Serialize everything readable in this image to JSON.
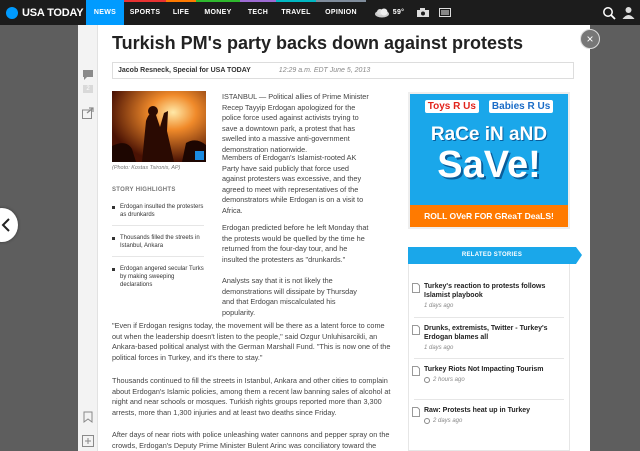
{
  "nav": {
    "logo": "USA TODAY",
    "items": [
      "NEWS",
      "SPORTS",
      "LIFE",
      "MONEY",
      "TECH",
      "TRAVEL",
      "OPINION"
    ],
    "temperature": "59°",
    "colors": {
      "news": "#009bff",
      "sports": "#e83131",
      "life": "#ff7a00",
      "money": "#2fb82e",
      "tech": "#9d6bd2",
      "travel": "#00b7c2",
      "opinion": "#7f8c9b"
    }
  },
  "article": {
    "title": "Turkish PM's party backs down against protests",
    "author": "Jacob Resneck, Special for USA TODAY",
    "date": "12:29 a.m. EDT June 5, 2013",
    "photo_caption": "(Photo: Kostas Tsironis, AP)",
    "highlights_title": "STORY HIGHLIGHTS",
    "highlights": [
      "Erdogan insulted the protesters as drunkards",
      "Thousands filled the streets in Istanbul, Ankara",
      "Erdogan angered secular Turks by making sweeping declarations"
    ],
    "paragraphs": [
      "ISTANBUL — Political allies of Prime Minister Recep Tayyip Erdogan apologized for the police force used against activists trying to save a downtown park, a protest that has swelled into a massive anti-government demonstration nationwide.",
      "Members of Erdogan's Islamist-rooted AK Party have said publicly that force used against protesters was excessive, and they agreed to meet with representatives of the demonstrators while Erdogan is on a visit to Africa.",
      "Erdogan predicted before he left Monday that the protests would be quelled by the time he returned from the four-day tour, and he insulted the protesters as \"drunkards.\"",
      "Analysts say that it is not likely the demonstrations will dissipate by Thursday and that Erdogan miscalculated his popularity.",
      "\"Even if Erdogan resigns today, the movement will be there as a latent force to come out when the leadership doesn't listen to the people,\" said Ozgur Unluhisarcikli, an Ankara-based political analyst with the German Marshall Fund. \"This is now one of the political forces in Turkey, and it's there to stay.\"",
      "Thousands continued to fill the streets in Istanbul, Ankara and other cities to complain about Erdogan's Islamic policies, among them a recent law banning sales of alcohol at night and near schools or mosques. Turkish rights groups reported more than 3,300 arrests, more than 1,300 injuries and at least two deaths since Friday.",
      "After days of near riots with police unleashing water cannons and pepper spray on the crowds, Erdogan's Deputy Prime Minister Bulent Arinc was conciliatory toward the"
    ],
    "comment_count": "2"
  },
  "ad": {
    "brand1": "Toys R Us",
    "brand2": "Babies R Us",
    "line1": "RaCe iN aND",
    "line2": "SaVe!",
    "cta": "ROLL OVeR FOR GReaT DeaLS!"
  },
  "related": {
    "title": "RELATED STORIES",
    "items": [
      {
        "title": "Turkey's reaction to protests follows Islamist playbook",
        "ago": "1 days ago"
      },
      {
        "title": "Drunks, extremists, Twitter - Turkey's Erdogan blames all",
        "ago": "1 days ago"
      },
      {
        "title": "Turkey Riots Not Impacting Tourism",
        "ago": "2 hours ago"
      },
      {
        "title": "Raw: Protests heat up in Turkey",
        "ago": "2 days ago"
      }
    ]
  }
}
